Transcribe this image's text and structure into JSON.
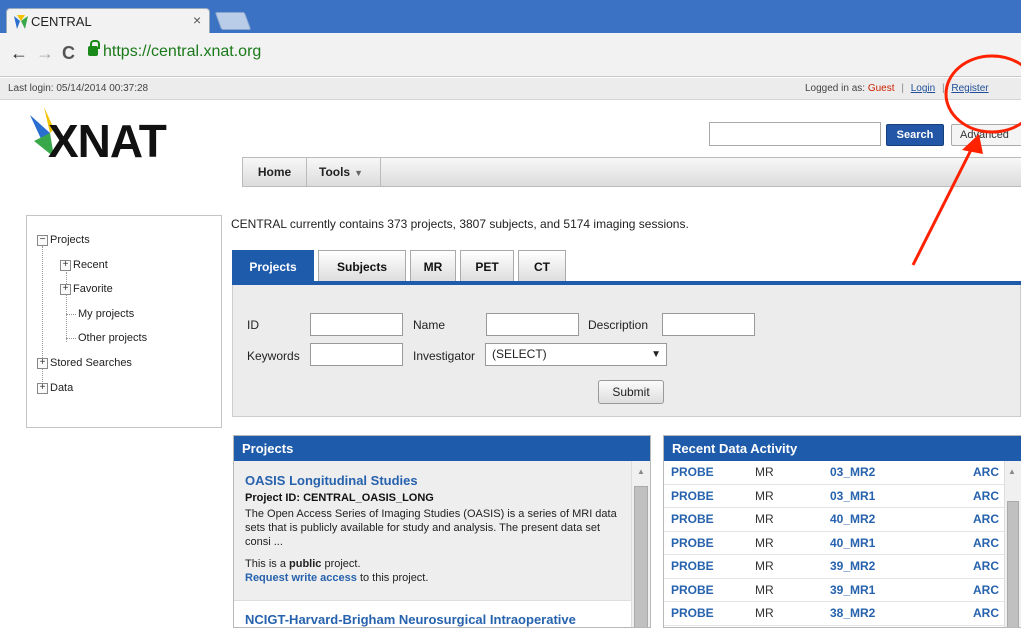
{
  "browser": {
    "tab_title": "CENTRAL",
    "tab_close": "×",
    "url": "https://central.xnat.org",
    "back": "←",
    "forward": "→",
    "reload": "C"
  },
  "header": {
    "last_login": "Last login: 05/14/2014 00:37:28",
    "logged_in_as": "Logged in as:",
    "guest": "Guest",
    "login": "Login",
    "separator": "|",
    "register": "Register"
  },
  "logo": {
    "text": "XNAT"
  },
  "search": {
    "value": "",
    "button": "Search",
    "advanced": "Advanced"
  },
  "menu": {
    "home": "Home",
    "tools": "Tools",
    "tools_caret": "▼"
  },
  "sidebar": {
    "projects": "Projects",
    "recent": "Recent",
    "favorite": "Favorite",
    "my_projects": "My projects",
    "other_projects": "Other projects",
    "stored_searches": "Stored Searches",
    "data": "Data"
  },
  "summary": "CENTRAL currently contains 373 projects, 3807 subjects, and 5174 imaging sessions.",
  "tabs": [
    "Projects",
    "Subjects",
    "MR",
    "PET",
    "CT"
  ],
  "form": {
    "id_label": "ID",
    "name_label": "Name",
    "description_label": "Description",
    "keywords_label": "Keywords",
    "investigator_label": "Investigator",
    "investigator_value": "(SELECT)",
    "submit": "Submit"
  },
  "projects_panel": {
    "header": "Projects",
    "items": [
      {
        "title": "OASIS Longitudinal Studies",
        "id_line": "Project ID: CENTRAL_OASIS_LONG",
        "desc": "The Open Access Series of Imaging Studies (OASIS) is a series of MRI data sets that is publicly available for study and analysis. The present data set consi ...",
        "public_prefix": "This is a ",
        "public_word": "public",
        "public_suffix": " project.",
        "request_link": "Request write access",
        "request_suffix": " to this project."
      },
      {
        "title": "NCIGT-Harvard-Brigham Neurosurgical Intraoperative"
      }
    ]
  },
  "recent_panel": {
    "header": "Recent Data Activity",
    "rows": [
      {
        "project": "PROBE",
        "modality": "MR",
        "label": "03_MR2",
        "archive": "ARC"
      },
      {
        "project": "PROBE",
        "modality": "MR",
        "label": "03_MR1",
        "archive": "ARC"
      },
      {
        "project": "PROBE",
        "modality": "MR",
        "label": "40_MR2",
        "archive": "ARC"
      },
      {
        "project": "PROBE",
        "modality": "MR",
        "label": "40_MR1",
        "archive": "ARC"
      },
      {
        "project": "PROBE",
        "modality": "MR",
        "label": "39_MR2",
        "archive": "ARC"
      },
      {
        "project": "PROBE",
        "modality": "MR",
        "label": "39_MR1",
        "archive": "ARC"
      },
      {
        "project": "PROBE",
        "modality": "MR",
        "label": "38_MR2",
        "archive": "ARC"
      }
    ]
  },
  "colors": {
    "accent": "#1f5bab",
    "link": "#2662ad",
    "annotation": "#ff2200",
    "tabbar": "#3b72c4"
  }
}
